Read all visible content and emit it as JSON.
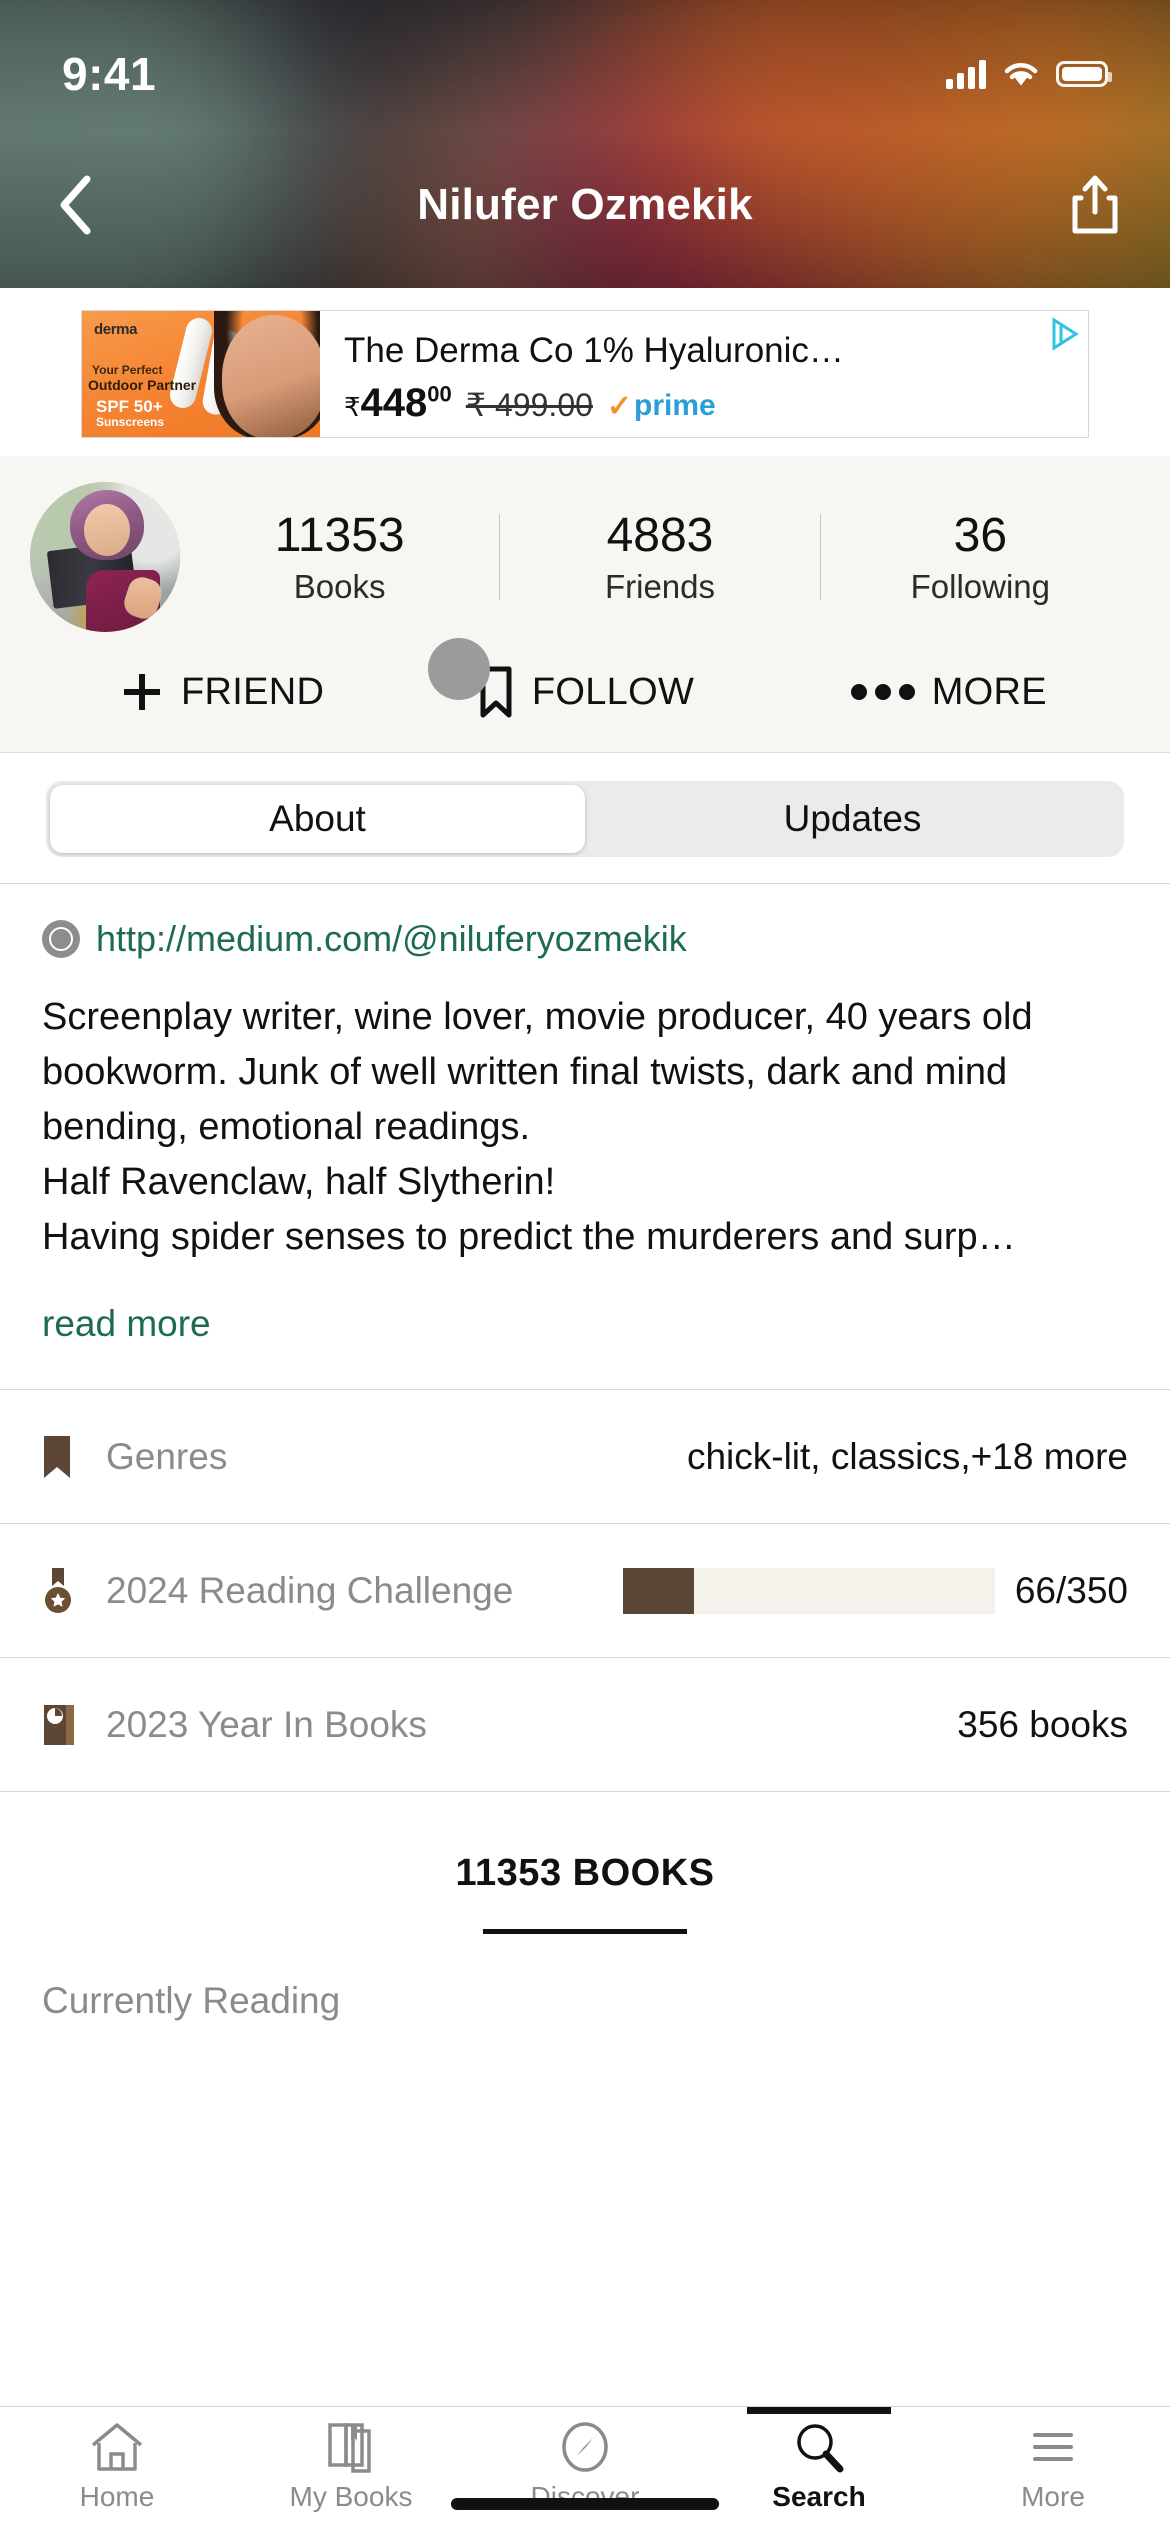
{
  "status_bar": {
    "time": "9:41",
    "cellular_icon": "signal-bars-icon",
    "wifi_icon": "wifi-icon",
    "battery_icon": "battery-icon"
  },
  "navbar": {
    "back_icon": "chevron-left-icon",
    "title": "Nilufer Ozmekik",
    "share_icon": "share-icon"
  },
  "ad": {
    "title": "The Derma Co 1% Hyaluronic…",
    "price_symbol": "₹",
    "price_whole": "448",
    "price_cents": "00",
    "old_price": "₹ 499.00",
    "prime_label": "prime",
    "prime_tick": "✓",
    "adchoices_icon": "adchoices-icon",
    "image_brand": "derma",
    "image_line1": "Your Perfect",
    "image_line2": "Outdoor Partner",
    "image_line3": "SPF 50+",
    "image_line4": "Sunscreens"
  },
  "profile": {
    "avatar_icon": "avatar",
    "stats": [
      {
        "number": "11353",
        "label": "Books"
      },
      {
        "number": "4883",
        "label": "Friends"
      },
      {
        "number": "36",
        "label": "Following"
      }
    ],
    "actions": [
      {
        "icon": "plus-icon",
        "label": "FRIEND"
      },
      {
        "icon": "bookmark-icon",
        "label": "FOLLOW"
      },
      {
        "icon": "ellipsis-icon",
        "label": "MORE"
      }
    ]
  },
  "tabs": {
    "about": "About",
    "updates": "Updates",
    "selected": "About"
  },
  "about": {
    "link_icon": "compass-icon",
    "website": "http://medium.com/@niluferyozmekik",
    "bio": "Screenplay writer, wine lover, movie producer, 40 years old bookworm. Junk of well written final twists, dark and mind bending, emotional readings.\nHalf Ravenclaw, half Slytherin!\nHaving spider senses to predict the murderers and surp…",
    "read_more": "read more"
  },
  "info_rows": [
    {
      "icon": "bookmark-icon",
      "label": "Genres",
      "value": "chick-lit, classics,+18 more",
      "type": "text"
    },
    {
      "icon": "medal-icon",
      "label": "2024 Reading Challenge",
      "value": "66/350",
      "type": "progress",
      "progress_current": 66,
      "progress_total": 350,
      "progress_percent": 19
    },
    {
      "icon": "yearbook-icon",
      "label": "2023 Year In Books",
      "value": "356 books",
      "type": "text"
    }
  ],
  "books_section": {
    "heading": "11353 BOOKS",
    "shelf_label": "Currently Reading"
  },
  "tabbar": {
    "items": [
      {
        "icon": "home-icon",
        "label": "Home",
        "active": false
      },
      {
        "icon": "books-icon",
        "label": "My Books",
        "active": false
      },
      {
        "icon": "compass-icon",
        "label": "Discover",
        "active": false
      },
      {
        "icon": "search-icon",
        "label": "Search",
        "active": true
      },
      {
        "icon": "menu-icon",
        "label": "More",
        "active": false
      }
    ]
  },
  "colors": {
    "cream": "#F7F6F2",
    "brown": "#5C4636",
    "green_link": "#1D6B55",
    "prime_blue": "#2A9FD6",
    "gray_label": "#8B8B8B"
  }
}
